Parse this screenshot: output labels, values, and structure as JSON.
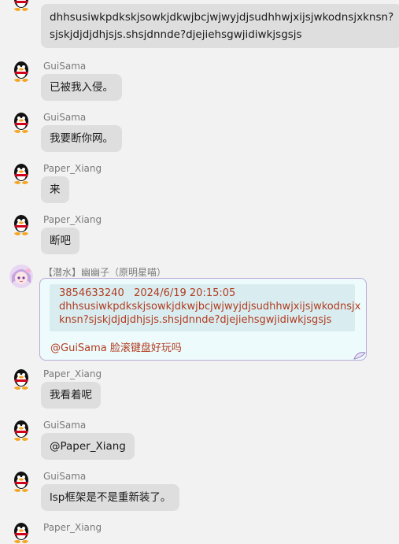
{
  "messages": [
    {
      "name": "",
      "lines": [
        "dhhsusiwkpdkskjsowkjdkwjbcjwjwyjdjsudhhwjxijsjwkodnsjxknsn?",
        "sjskjdjdjdhjsjs.shsjdnnde?djejiehsgwjidiwkjsgsjs"
      ]
    },
    {
      "name": "GuiSama",
      "text": "已被我入侵。"
    },
    {
      "name": "GuiSama",
      "text": "我要断你网。"
    },
    {
      "name": "Paper_Xiang",
      "text": "来"
    },
    {
      "name": "Paper_Xiang",
      "text": "断吧"
    },
    {
      "name": "【潜水】幽幽子（原明星喵）",
      "quote": {
        "header": "3854633240   2024/6/19 20:15:05",
        "lines": [
          "dhhsusiwkpdkskjsowkjdkwjbcjwjwyjdjsudhhwjxijsjwkodnsjx",
          "knsn?sjskjdjdjdhjsjs.shsjdnnde?djejiehsgwjidiwkjsgsjs"
        ],
        "reply": "@GuiSama 脸滚键盘好玩吗"
      }
    },
    {
      "name": "Paper_Xiang",
      "text": "我看着呢"
    },
    {
      "name": "GuiSama",
      "text": "@Paper_Xiang"
    },
    {
      "name": "GuiSama",
      "text": "lsp框架是不是重新装了。"
    },
    {
      "name": "Paper_Xiang",
      "text": ""
    }
  ],
  "colors": {
    "bubble": "#dedede",
    "quote_text": "#b13b1e",
    "quote_bg": "#eefbfd",
    "quote_inner_bg": "#d9edf1",
    "border": "#b8a8d6"
  },
  "icons": {
    "avatar_default": "qq-penguin-icon",
    "avatar_special": "anime-girl-avatar-icon"
  }
}
